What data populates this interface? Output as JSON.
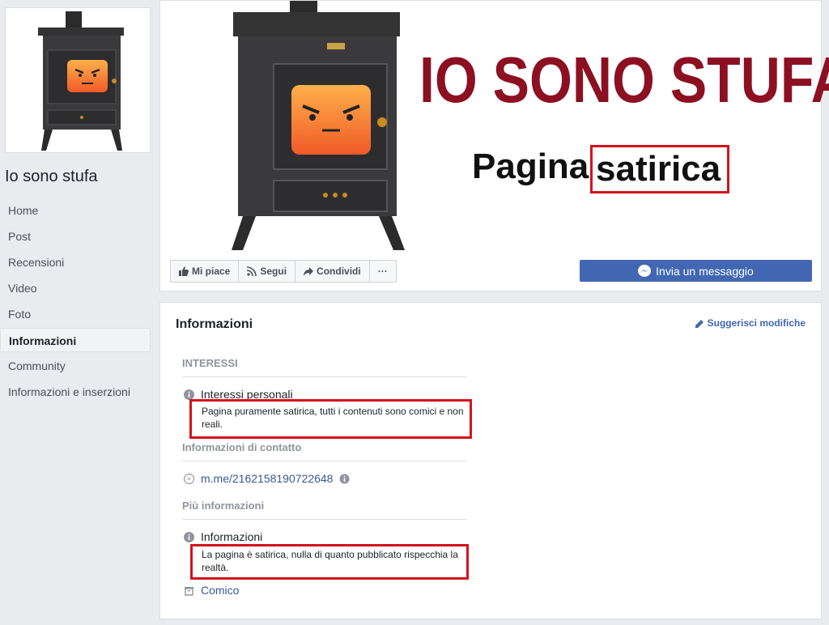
{
  "page": {
    "name": "Io sono stufa"
  },
  "sidebar": {
    "items": [
      {
        "label": "Home"
      },
      {
        "label": "Post"
      },
      {
        "label": "Recensioni"
      },
      {
        "label": "Video"
      },
      {
        "label": "Foto"
      },
      {
        "label": "Informazioni"
      },
      {
        "label": "Community"
      },
      {
        "label": "Informazioni e inserzioni"
      }
    ],
    "active_index": 5
  },
  "cover": {
    "title": "IO SONO STUFA",
    "subtitle_a": "Pagina",
    "subtitle_b": "satirica"
  },
  "actions": {
    "like": "Mi piace",
    "follow": "Segui",
    "share": "Condividi",
    "more": "···",
    "message": "Invia un messaggio"
  },
  "info": {
    "title": "Informazioni",
    "suggest": "Suggerisci modifiche",
    "interests_head": "INTERESSI",
    "personal_label": "Interessi personali",
    "personal_desc": "Pagina puramente satirica, tutti i contenuti sono comici e non reali.",
    "contact_head": "Informazioni di contatto",
    "messenger_link": "m.me/2162158190722648",
    "more_head": "Più informazioni",
    "about_label": "Informazioni",
    "about_desc": "La pagina è satirica, nulla di quanto pubblicato rispecchia la realtà.",
    "category": "Comico"
  },
  "colors": {
    "brand": "#4267b2",
    "highlight": "#d3131d",
    "cover_title": "#8c1022"
  }
}
